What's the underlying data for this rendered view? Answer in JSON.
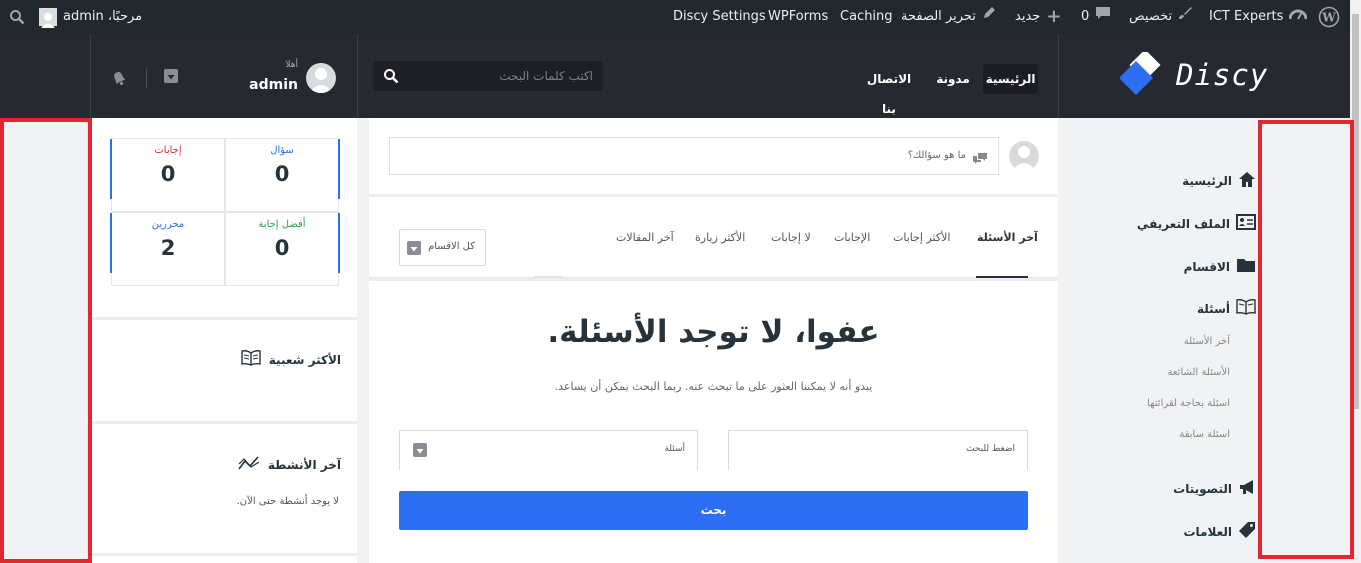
{
  "admin_bar": {
    "site_name": "ICT Experts",
    "customize": "تخصيص",
    "comments_count": "0",
    "new": "جديد",
    "edit_page": "تحرير الصفحة",
    "caching": "Caching",
    "wpforms": "WPForms",
    "discy_settings": "Discy Settings",
    "greeting": "مرحبًا، admin"
  },
  "header": {
    "logo": "Discy",
    "nav": [
      "الرئيسية",
      "مدونة",
      "الاتصال بنا"
    ],
    "search_placeholder": "اكتب كلمات البحث",
    "user_hello": "أهلا",
    "user_name": "admin"
  },
  "sidebar_right": {
    "items": [
      {
        "label": "الرئيسية",
        "icon": "home-icon"
      },
      {
        "label": "الملف التعريفي",
        "icon": "profile-card-icon"
      },
      {
        "label": "الاقسام",
        "icon": "folder-icon"
      },
      {
        "label": "أسئلة",
        "icon": "book-icon"
      }
    ],
    "subitems": [
      "آخر الأسئلة",
      "الأسئلة الشائعة",
      "اسئلة بحاجة لقرائتها",
      "اسئلة سابقة"
    ],
    "bottom_items": [
      {
        "label": "التصويتات",
        "icon": "megaphone-icon"
      },
      {
        "label": "العلامات",
        "icon": "tag-icon"
      }
    ]
  },
  "ask_box": {
    "placeholder": "ما هو سؤالك؟"
  },
  "tabs": [
    "آخر الأسئلة",
    "الأكثر إجابات",
    "الإجابات",
    "لا إجابات",
    "الأكثر زيارة",
    "آخر المقالات"
  ],
  "category_select": "كل الاقسام",
  "empty_state": {
    "title": "عفوا، لا توجد الأسئلة.",
    "text": "يبدو أنه لا يمكننا العثور على ما تبحث عنه. ربما البحث يمكن أن يساعد."
  },
  "search_form": {
    "input_placeholder": "اضغط للبحث",
    "type_select": "أسئلة",
    "button": "بحث"
  },
  "stats": [
    {
      "label": "سؤال",
      "value": "0",
      "color": "#2d6ff3"
    },
    {
      "label": "إجابات",
      "value": "0",
      "color": "#e3262f"
    },
    {
      "label": "أفضل إجابة",
      "value": "0",
      "color": "#2aa24a"
    },
    {
      "label": "محررين",
      "value": "2",
      "color": "#2d6ff3"
    }
  ],
  "widgets": {
    "popular": "الأكثر شعبية",
    "activity": "آخر الأنشطة",
    "activity_empty": "لا يوجد أنشطة حتى الآن."
  }
}
